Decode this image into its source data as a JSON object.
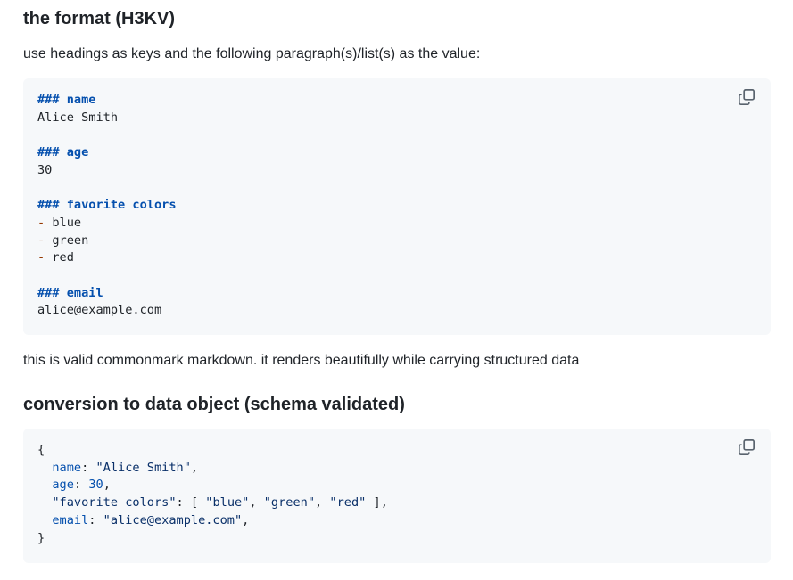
{
  "section1": {
    "heading": "the format (H3KV)",
    "intro": "use headings as keys and the following paragraph(s)/list(s) as the value:",
    "code": {
      "h_name": "### name",
      "v_name": "Alice Smith",
      "h_age": "### age",
      "v_age": "30",
      "h_colors": "### favorite colors",
      "dash": "-",
      "colors": [
        "blue",
        "green",
        "red"
      ],
      "h_email": "### email",
      "v_email": "alice@example.com"
    }
  },
  "note": "this is valid commonmark markdown. it renders beautifully while carrying structured data",
  "section2": {
    "heading": "conversion to data object (schema validated)",
    "code": {
      "open": "{",
      "k_name": "name",
      "v_name": "\"Alice Smith\"",
      "k_age": "age",
      "v_age": "30",
      "k_colors": "\"favorite colors\"",
      "v_colors": [
        "\"blue\"",
        "\"green\"",
        "\"red\""
      ],
      "k_email": "email",
      "v_email": "\"alice@example.com\"",
      "close": "}"
    }
  },
  "icons": {
    "copy": "copy-icon"
  }
}
